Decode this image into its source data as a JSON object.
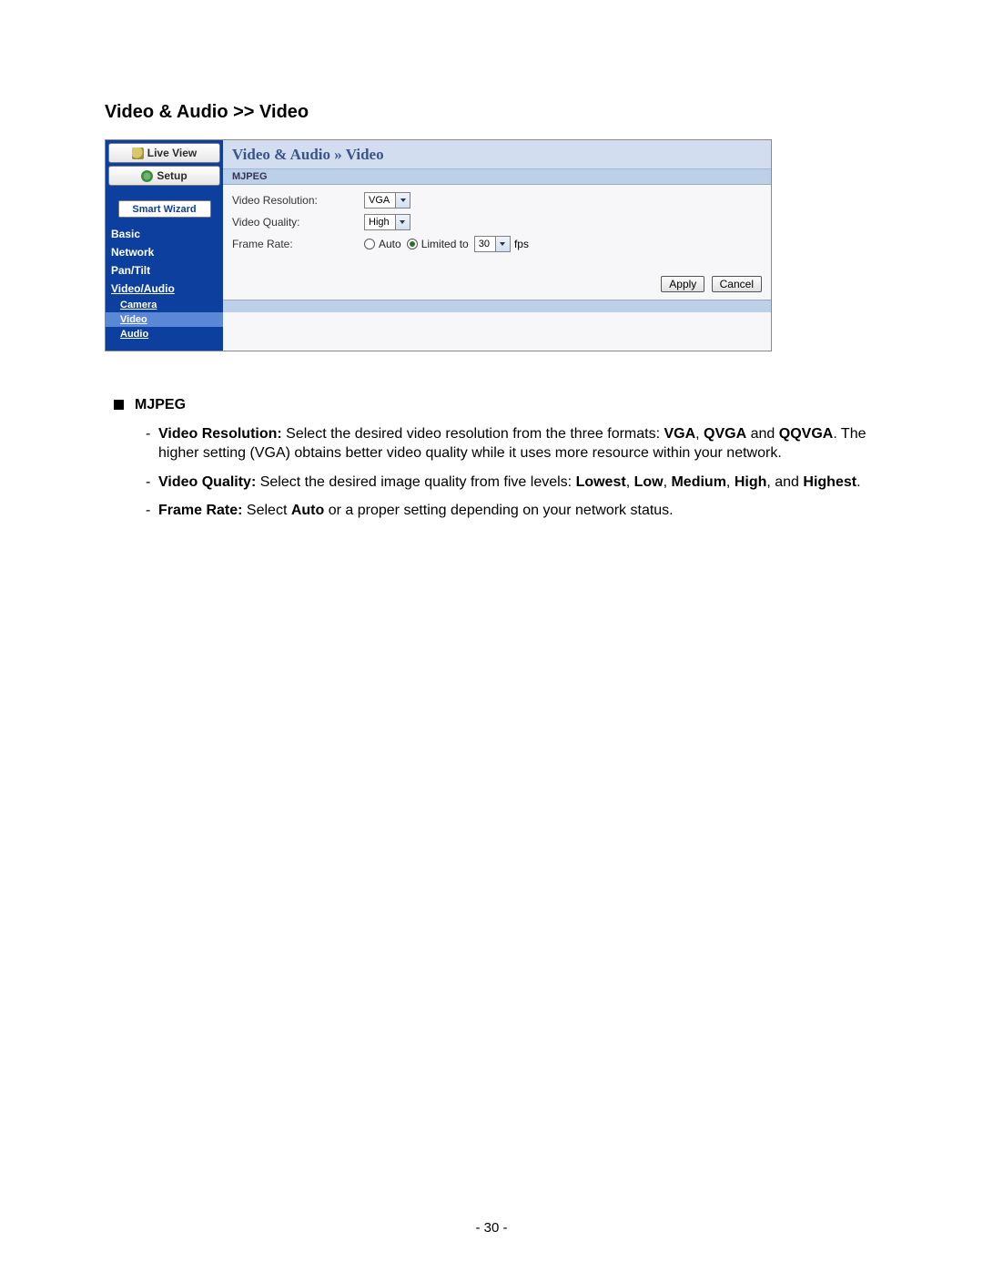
{
  "page_title": "Video & Audio >> Video",
  "sidebar": {
    "live_view": "Live View",
    "setup": "Setup",
    "smart_wizard": "Smart Wizard",
    "items": [
      {
        "label": "Basic"
      },
      {
        "label": "Network"
      },
      {
        "label": "Pan/Tilt"
      },
      {
        "label": "Video/Audio"
      }
    ],
    "subitems": [
      {
        "label": "Camera"
      },
      {
        "label": "Video"
      },
      {
        "label": "Audio"
      }
    ]
  },
  "panel": {
    "breadcrumb_a": "Video & Audio",
    "breadcrumb_sep": " » ",
    "breadcrumb_b": "Video",
    "section": "MJPEG",
    "rows": {
      "res_label": "Video Resolution:",
      "res_value": "VGA",
      "qual_label": "Video Quality:",
      "qual_value": "High",
      "fr_label": "Frame Rate:",
      "fr_auto": "Auto",
      "fr_limited": "Limited to",
      "fr_value": "30",
      "fr_unit": "fps"
    },
    "apply": "Apply",
    "cancel": "Cancel"
  },
  "doc": {
    "heading": "MJPEG",
    "b1_lead": "Video Resolution:",
    "b1_a": " Select the desired video resolution from the three formats: ",
    "b1_vga": "VGA",
    "b1_c1": ", ",
    "b1_qvga": "QVGA",
    "b1_c2": " and ",
    "b1_qqvga": "QQVGA",
    "b1_b": ". The higher setting (VGA) obtains better video quality while it uses more resource within your network.",
    "b2_lead": "Video Quality:",
    "b2_a": " Select the desired image quality from five levels: ",
    "b2_lowest": "Lowest",
    "b2_c1": ", ",
    "b2_low": "Low",
    "b2_c2": ", ",
    "b2_medium": "Medium",
    "b2_c3": ", ",
    "b2_high": "High",
    "b2_c4": ", and ",
    "b2_highest": "Highest",
    "b2_end": ".",
    "b3_lead": "Frame Rate:",
    "b3_a": " Select ",
    "b3_auto": "Auto",
    "b3_b": " or a proper setting depending on your network status."
  },
  "page_number": "- 30 -"
}
